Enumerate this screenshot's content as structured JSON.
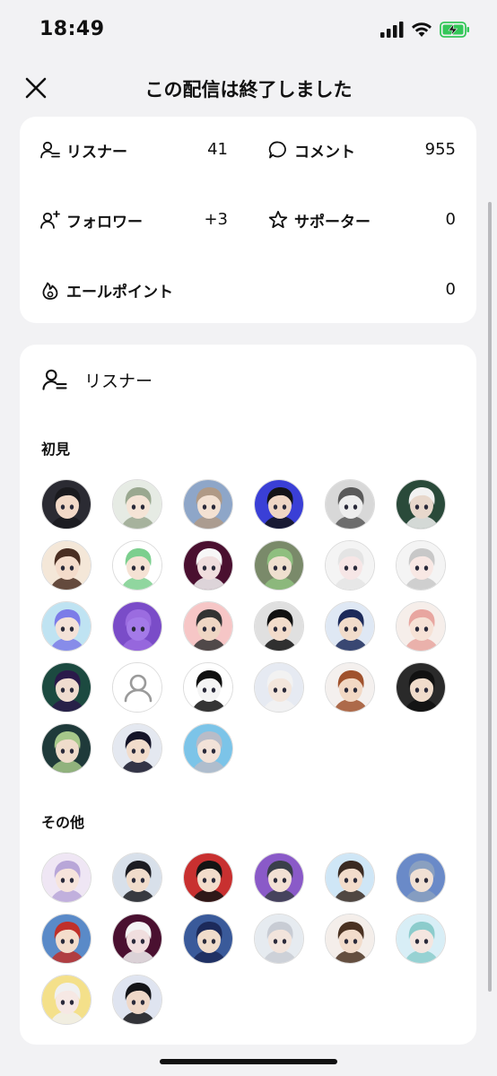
{
  "status_bar": {
    "time": "18:49"
  },
  "header": {
    "title": "この配信は終了しました"
  },
  "stats": {
    "listeners": {
      "label": "リスナー",
      "value": "41"
    },
    "comments": {
      "label": "コメント",
      "value": "955"
    },
    "follows": {
      "label": "フォロワー",
      "value": "+3"
    },
    "supporters": {
      "label": "サポーター",
      "value": "0"
    },
    "yell_points": {
      "label": "エールポイント",
      "value": "0"
    }
  },
  "listeners_section": {
    "title": "リスナー",
    "first_time_title": "初見",
    "other_title": "その他",
    "first_time_count": 27,
    "other_count": 14
  },
  "colors": {
    "battery": "#34c759",
    "card_bg": "#ffffff",
    "page_bg": "#f2f2f4"
  }
}
